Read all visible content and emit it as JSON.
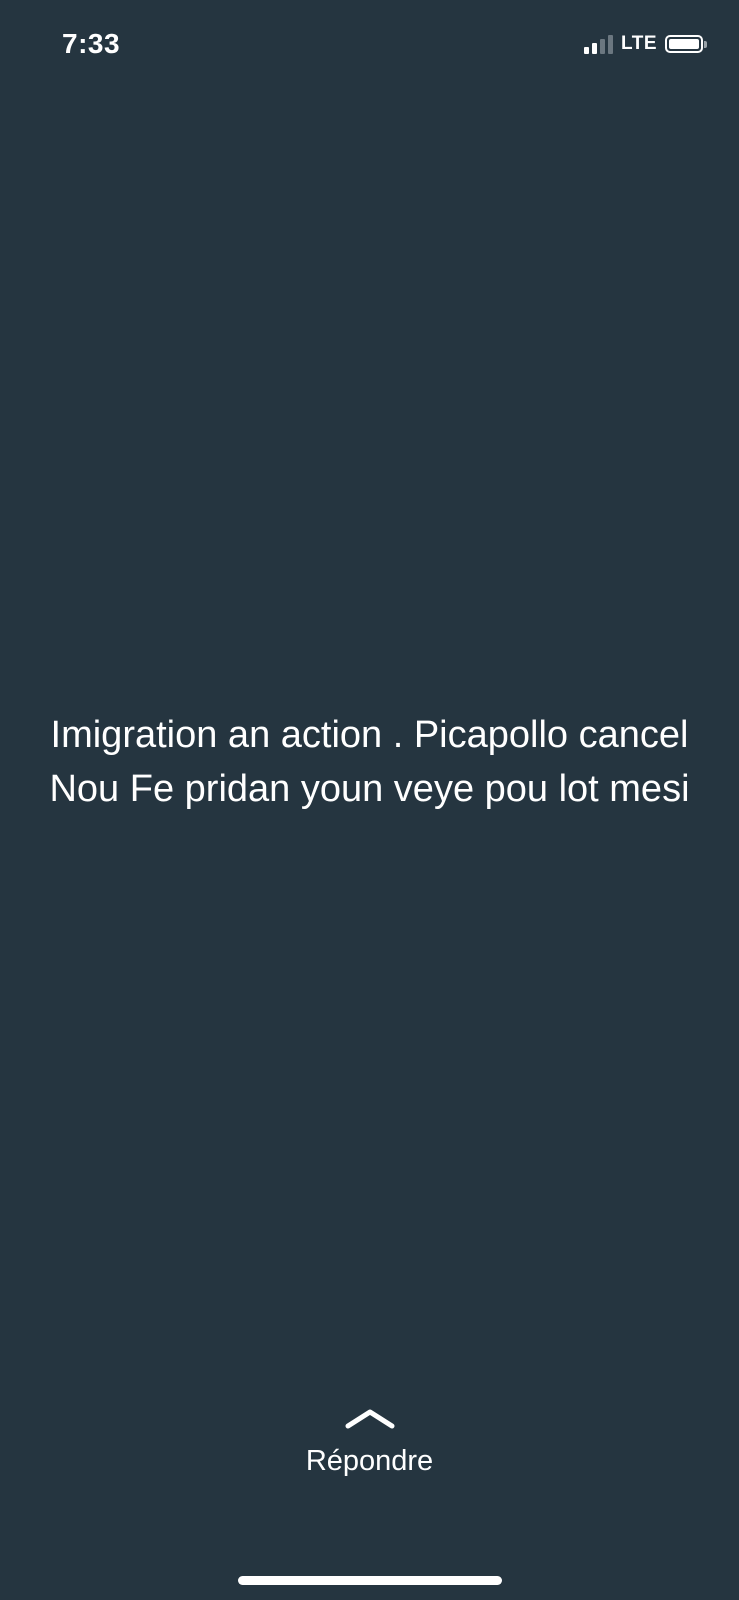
{
  "status_bar": {
    "time": "7:33",
    "network": "LTE",
    "signal_bars_active": 2,
    "signal_bars_total": 4,
    "battery_level": 1.0
  },
  "message": {
    "text": "Imigration an action . Picapollo cancel Nou Fe pridan youn veye pou lot mesi"
  },
  "reply": {
    "icon": "chevron-up-icon",
    "label": "Répondre"
  },
  "colors": {
    "background": "#253540",
    "foreground": "#ffffff",
    "dim": "#6b7780"
  }
}
